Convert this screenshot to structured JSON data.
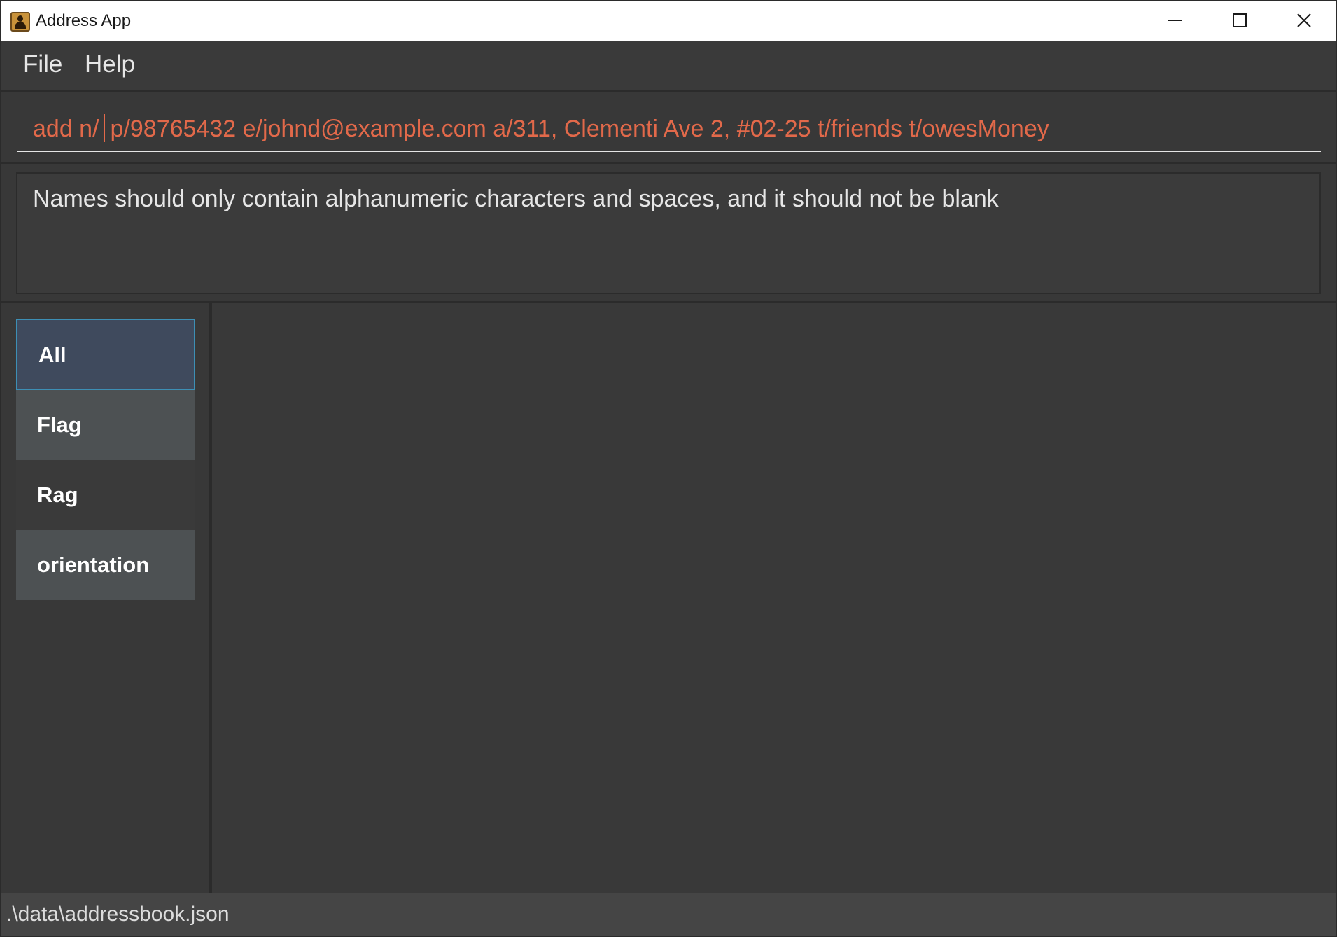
{
  "window": {
    "title": "Address App",
    "icon": "address-book-icon"
  },
  "menu": {
    "file": "File",
    "help": "Help"
  },
  "command": {
    "text_before_caret": "add n/",
    "text_after_caret": "p/98765432 e/johnd@example.com a/311, Clementi Ave 2, #02-25 t/friends t/owesMoney",
    "color": "#e2694a"
  },
  "result": {
    "message": "Names should only contain alphanumeric characters and spaces, and it should not be blank"
  },
  "tabs": [
    {
      "label": "All",
      "selected": true
    },
    {
      "label": "Flag",
      "selected": false
    },
    {
      "label": "Rag",
      "selected": false
    },
    {
      "label": "orientation",
      "selected": false
    }
  ],
  "status": {
    "file_path": ".\\data\\addressbook.json"
  },
  "colors": {
    "background": "#3a3a3a",
    "selected_tab": "#3f4a5d",
    "selected_border": "#3d8fb5",
    "error_text": "#e2694a"
  }
}
